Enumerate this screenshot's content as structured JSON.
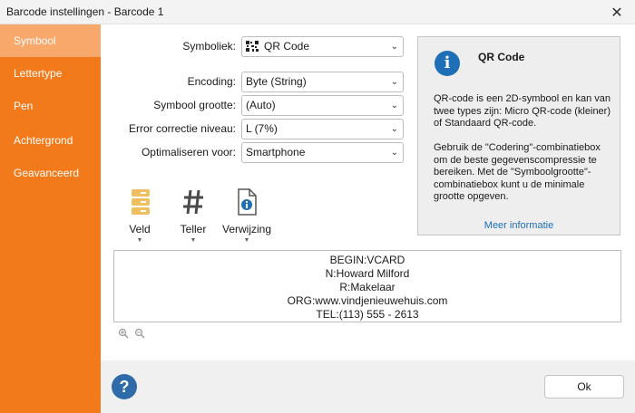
{
  "window": {
    "title": "Barcode instellingen - Barcode 1",
    "close_glyph": "✕"
  },
  "sidebar": {
    "items": [
      {
        "label": "Symbool",
        "active": true
      },
      {
        "label": "Lettertype"
      },
      {
        "label": "Pen"
      },
      {
        "label": "Achtergrond"
      },
      {
        "label": "Geavanceerd"
      }
    ]
  },
  "form": {
    "symboliek": {
      "label": "Symboliek:",
      "value": "QR Code",
      "icon": "qr-code-icon"
    },
    "encoding": {
      "label": "Encoding:",
      "value": "Byte (String)"
    },
    "symbool_grootte": {
      "label": "Symbool grootte:",
      "value": "(Auto)"
    },
    "error_correctie": {
      "label": "Error correctie niveau:",
      "value": "L (7%)"
    },
    "optimaliseren": {
      "label": "Optimaliseren voor:",
      "value": "Smartphone"
    }
  },
  "info": {
    "title": "QR Code",
    "paragraph1": "QR-code is een 2D-symbool en kan van twee types zijn: Micro QR-code (kleiner) of Standaard QR-code.",
    "paragraph2": "Gebruik de \"Codering\"-combinatiebox om de beste gegevenscompressie te bereiken. Met de \"Symboolgrootte\"-combinatiebox kunt u de minimale grootte opgeven.",
    "link": "Meer informatie",
    "icon": "info-icon"
  },
  "tools": [
    {
      "label": "Veld",
      "icon": "database-field-icon"
    },
    {
      "label": "Teller",
      "icon": "hash-counter-icon"
    },
    {
      "label": "Verwijzing",
      "icon": "document-info-icon"
    }
  ],
  "data_text": [
    "BEGIN:VCARD",
    "N:Howard Milford",
    "R:Makelaar",
    "ORG:www.vindjenieuwehuis.com",
    "TEL:(113) 555 - 2613"
  ],
  "footer": {
    "ok_label": "Ok",
    "help_glyph": "?"
  },
  "colors": {
    "sidebar": "#f27a1a",
    "sidebar_active": "#f7a86a",
    "accent_blue": "#1e6fb5",
    "field_icon": "#f0c060"
  }
}
